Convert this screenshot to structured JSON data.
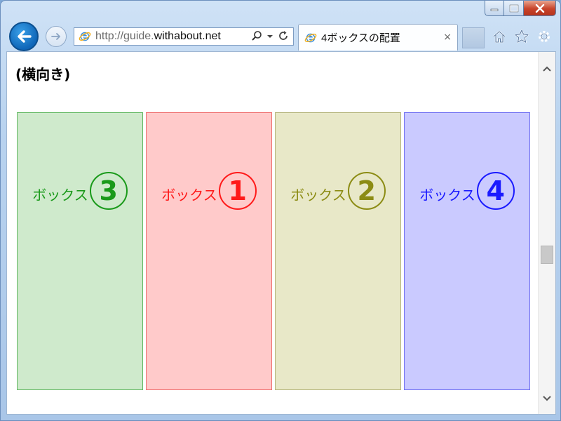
{
  "browser": {
    "url_prefix": "http://guide.",
    "url_domain": "withabout.net",
    "tab_title": "4ボックスの配置",
    "tab_close": "×"
  },
  "page": {
    "heading": "(横向き)",
    "boxes": [
      {
        "text": "ボックス",
        "number": "3",
        "color": "#1a9a1a",
        "bg": "#cfeacc",
        "border": "#62b862"
      },
      {
        "text": "ボックス",
        "number": "1",
        "color": "#ff1a1a",
        "bg": "#ffcaca",
        "border": "#ef6e6e"
      },
      {
        "text": "ボックス",
        "number": "2",
        "color": "#8c8c14",
        "bg": "#e8e8c8",
        "border": "#b4b47a"
      },
      {
        "text": "ボックス",
        "number": "4",
        "color": "#1a1aff",
        "bg": "#cacaff",
        "border": "#6e6ef2"
      }
    ]
  },
  "icons": {
    "back": "back-arrow-icon",
    "forward": "forward-arrow-icon",
    "ie": "internet-explorer-icon",
    "search": "search-icon",
    "dropdown": "dropdown-arrow-icon",
    "refresh": "refresh-icon",
    "home": "home-icon",
    "favorites": "star-icon",
    "settings": "gear-icon"
  }
}
